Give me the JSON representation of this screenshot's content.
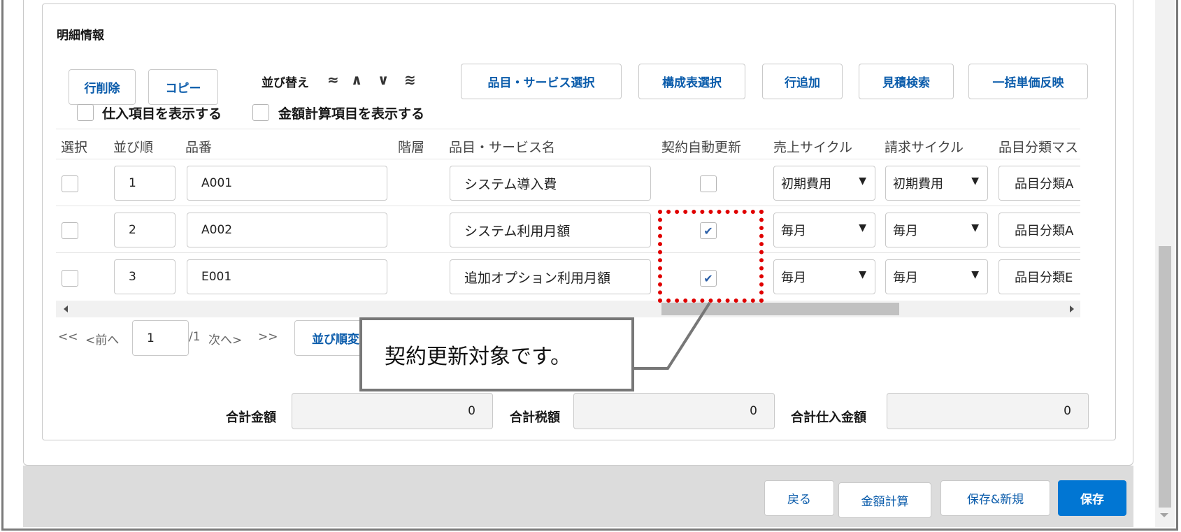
{
  "section": {
    "title": "明細情報"
  },
  "toolbar": {
    "delete_row": "行削除",
    "copy": "コピー",
    "sort_label": "並び替え",
    "sort_arrows": [
      "≈",
      "∧",
      "∨",
      "≋"
    ],
    "item_service_select": "品目・サービス選択",
    "bom_select": "構成表選択",
    "add_row": "行追加",
    "quote_search": "見積検索",
    "bulk_price": "一括単価反映"
  },
  "options": {
    "show_purchase": "仕入項目を表示する",
    "show_amount_calc": "金額計算項目を表示する"
  },
  "table": {
    "headers": [
      "選択",
      "並び順",
      "品番",
      "階層",
      "品目・サービス名",
      "契約自動更新",
      "売上サイクル",
      "請求サイクル",
      "品目分類マス"
    ],
    "rows": [
      {
        "order": "1",
        "code": "A001",
        "name": "システム導入費",
        "auto_renew": false,
        "sales_cycle": "初期費用",
        "billing_cycle": "初期費用",
        "category": "品目分類A"
      },
      {
        "order": "2",
        "code": "A002",
        "name": "システム利用月額",
        "auto_renew": true,
        "sales_cycle": "毎月",
        "billing_cycle": "毎月",
        "category": "品目分類A"
      },
      {
        "order": "3",
        "code": "E001",
        "name": "追加オプション利用月額",
        "auto_renew": true,
        "sales_cycle": "毎月",
        "billing_cycle": "毎月",
        "category": "品目分類E"
      }
    ],
    "check_mark": "✔"
  },
  "pager": {
    "first": "<<",
    "prev": "<前へ",
    "page_value": "1",
    "total": "/1",
    "next": "次へ>",
    "last": ">>",
    "reorder_button": "並び順変更"
  },
  "totals": {
    "amount_label": "合計金額",
    "amount_value": "0",
    "tax_label": "合計税額",
    "tax_value": "0",
    "purchase_label": "合計仕入金額",
    "purchase_value": "0"
  },
  "footer": {
    "back": "戻る",
    "calc": "金額計算",
    "save_new": "保存&新規",
    "save": "保存"
  },
  "annotation": {
    "callout_text": "契約更新対象です。"
  },
  "colors": {
    "brand": "#0176d3",
    "link": "#0b5cab",
    "highlight": "#e00000"
  }
}
